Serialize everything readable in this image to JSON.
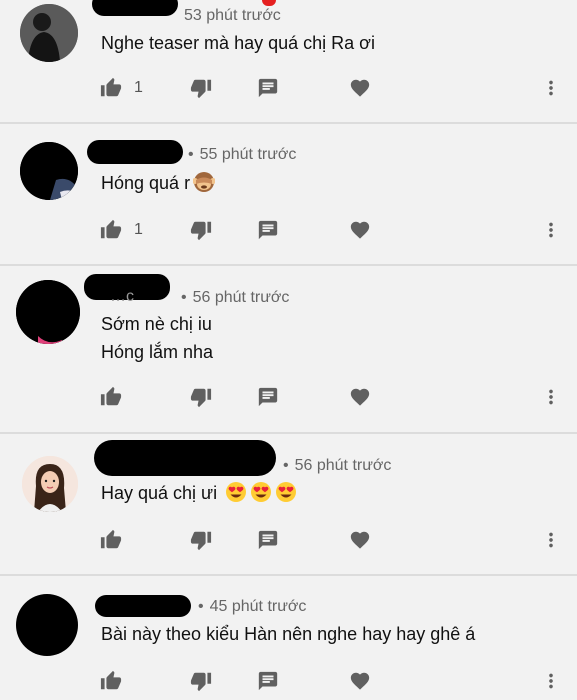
{
  "comments": [
    {
      "time": "53 phút trước",
      "show_dot": false,
      "lines": [
        "Nghe teaser mà hay quá chị Ra ơi"
      ],
      "like_count": "1",
      "emoji": ""
    },
    {
      "time": "55 phút trước",
      "show_dot": true,
      "lines": [
        "Hóng quá r"
      ],
      "like_count": "1",
      "emoji": "see-no-evil-monkey"
    },
    {
      "time": "56 phút trước",
      "show_dot": true,
      "lines": [
        "Sớm nè chị iu",
        "Hóng lắm nha"
      ],
      "like_count": "",
      "emoji": "",
      "name_fragment": "…c"
    },
    {
      "time": "56 phút trước",
      "show_dot": true,
      "lines": [
        "Hay quá chị ưi"
      ],
      "like_count": "",
      "emoji": "heart-eyes-x3"
    },
    {
      "time": "45 phút trước",
      "show_dot": true,
      "lines": [
        "Bài này theo kiểu Hàn nên nghe hay hay ghê á"
      ],
      "like_count": "",
      "emoji": ""
    }
  ],
  "colors": {
    "background": "#f2f2f2",
    "divider": "#dcdcdc",
    "icon": "#606060",
    "redaction": "#000000",
    "notification_dot": "#e52020"
  },
  "icons": [
    "thumb-up-icon",
    "thumb-down-icon",
    "reply-icon",
    "heart-icon",
    "more-vert-icon"
  ]
}
